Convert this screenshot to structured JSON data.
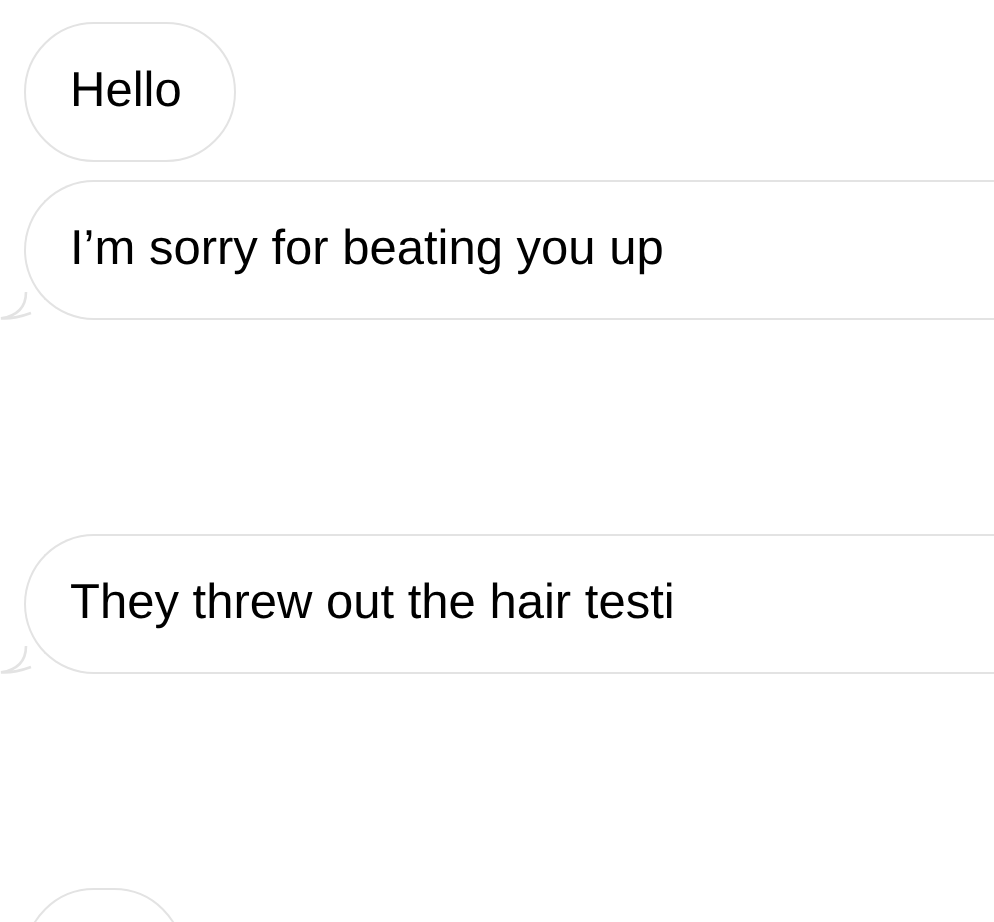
{
  "messages": [
    {
      "text": "Hello",
      "tail": false
    },
    {
      "text": "I’m sorry for beating you up",
      "tail": true
    },
    {
      "text": "They threw out the hair testi",
      "tail": true
    },
    {
      "tail": false
    }
  ]
}
